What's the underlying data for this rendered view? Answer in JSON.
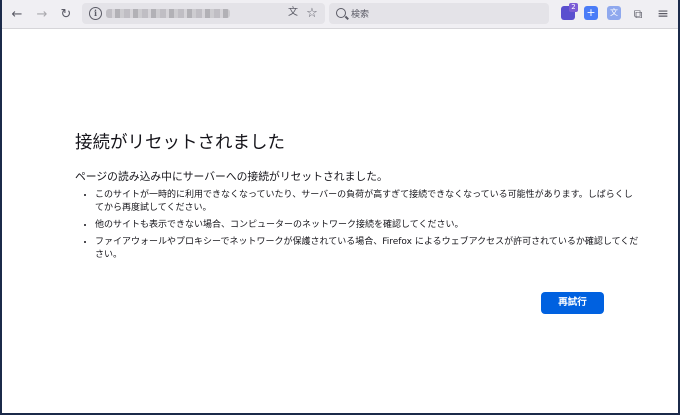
{
  "toolbar": {
    "back_icon": "←",
    "forward_icon": "→",
    "reload_icon": "↻",
    "search_placeholder": "検索",
    "translate_icon": "文",
    "bookmark_icon": "☆",
    "extension_badge": "2",
    "menu_icon": "≡"
  },
  "error": {
    "title": "接続がリセットされました",
    "lead": "ページの読み込み中にサーバーへの接続がリセットされました。",
    "bullets": [
      "このサイトが一時的に利用できなくなっていたり、サーバーの負荷が高すぎて接続できなくなっている可能性があります。しばらくしてから再度試してください。",
      "他のサイトも表示できない場合、コンピューターのネットワーク接続を確認してください。",
      "ファイアウォールやプロキシーでネットワークが保護されている場合、Firefox によるウェブアクセスが許可されているか確認してください。"
    ],
    "retry_label": "再試行"
  },
  "colors": {
    "accent": "#0061e0",
    "toolbar_bg": "#f0eff3",
    "text": "#15141a"
  }
}
